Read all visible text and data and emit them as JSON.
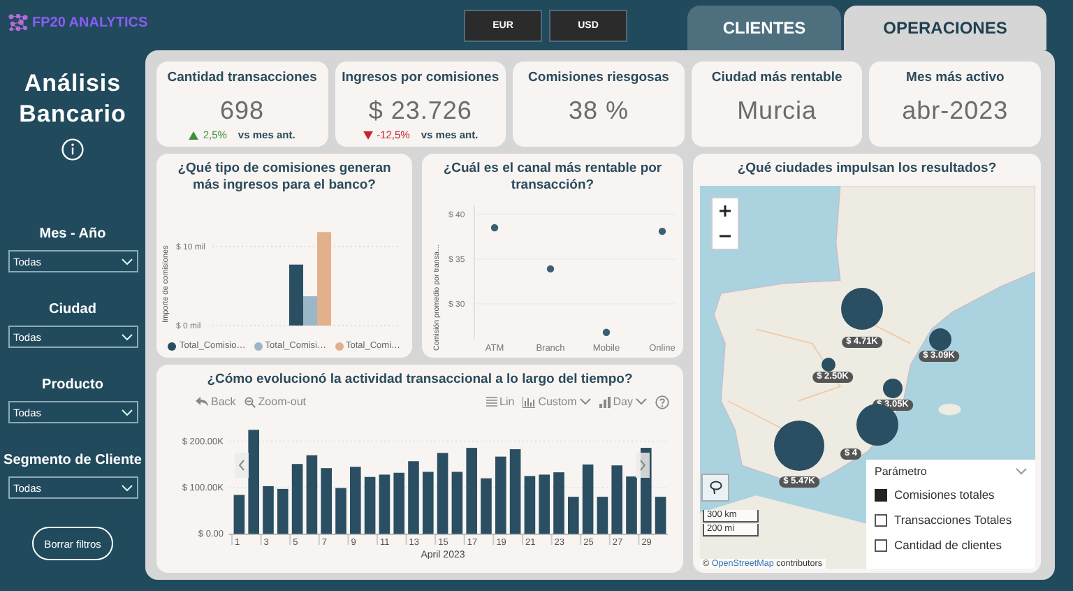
{
  "brand": {
    "name": "FP20 ANALYTICS"
  },
  "currency_buttons": [
    "EUR",
    "USD"
  ],
  "tabs": [
    {
      "label": "CLIENTES",
      "selected": false
    },
    {
      "label": "OPERACIONES",
      "selected": true
    }
  ],
  "sidebar": {
    "title": "Análisis Bancario",
    "filters": [
      {
        "label": "Mes - Año",
        "value": "Todas"
      },
      {
        "label": "Ciudad",
        "value": "Todas"
      },
      {
        "label": "Producto",
        "value": "Todas"
      },
      {
        "label": "Segmento de Cliente",
        "value": "Todas"
      }
    ],
    "clear_button": "Borrar filtros"
  },
  "kpis": [
    {
      "title": "Cantidad transacciones",
      "value": "698",
      "change": {
        "increase": true,
        "value": "2,5%",
        "caption": "vs mes ant."
      }
    },
    {
      "title": "Ingresos por comisiones",
      "value": "$ 23.726",
      "change": {
        "increase": false,
        "value": "-12,5%",
        "caption": "vs mes ant."
      }
    },
    {
      "title": "Comisiones riesgosas",
      "value": "38 %"
    },
    {
      "title": "Ciudad más rentable",
      "value": "Murcia"
    },
    {
      "title": "Mes más activo",
      "value": "abr-2023"
    }
  ],
  "commission_chart": {
    "title": "¿Qué tipo de comisiones generan más ingresos para el banco?",
    "chart_data": {
      "type": "bar",
      "ylabel": "Importe de comisiones",
      "grid": true,
      "ylim": [
        0,
        12
      ],
      "yticks": [
        {
          "value": 0,
          "label": "$ 0 mil"
        },
        {
          "value": 10,
          "label": "$ 10 mil"
        }
      ],
      "series": [
        {
          "name": "Total_Comisio…",
          "color": "#2a4e62",
          "values": [
            7.7
          ]
        },
        {
          "name": "Total_Comisi…",
          "color": "#9ab7c8",
          "values": [
            3.7
          ]
        },
        {
          "name": "Total_Comi…",
          "color": "#e3b08c",
          "values": [
            11.8
          ]
        }
      ]
    }
  },
  "channel_chart": {
    "title": "¿Cuál es el canal más rentable por transacción?",
    "chart_data": {
      "type": "scatter",
      "ylabel": "Comisión promedio por transa…",
      "categories": [
        "ATM",
        "Branch",
        "Mobile",
        "Online"
      ],
      "grid": true,
      "ylim": [
        26,
        41
      ],
      "yticks": [
        {
          "value": 30,
          "label": "$ 30"
        },
        {
          "value": 35,
          "label": "$ 35"
        },
        {
          "value": 40,
          "label": "$ 40"
        }
      ],
      "series": [
        {
          "color": "#3b5f72",
          "values": [
            38.5,
            33.9,
            26.8,
            38.1
          ]
        }
      ]
    }
  },
  "activity_chart": {
    "title": "¿Cómo evolucionó la actividad transaccional a lo largo del tiempo?",
    "toolbar": {
      "back": "Back",
      "zoom_out": "Zoom-out",
      "scale": "Lin",
      "custom": "Custom",
      "period": "Day"
    },
    "chart_data": {
      "type": "bar",
      "xlabel": "April 2023",
      "x": [
        1,
        2,
        3,
        4,
        5,
        6,
        7,
        8,
        9,
        10,
        11,
        12,
        13,
        14,
        15,
        16,
        17,
        18,
        19,
        20,
        21,
        22,
        23,
        24,
        25,
        26,
        27,
        28,
        29,
        30
      ],
      "grid": true,
      "xlim": [
        0.5,
        30.5
      ],
      "xticks": [
        1,
        3,
        5,
        7,
        9,
        11,
        13,
        15,
        17,
        19,
        21,
        23,
        25,
        27,
        29
      ],
      "ylim": [
        0,
        230000
      ],
      "yticks": [
        {
          "value": 0,
          "label": "$ 0.00"
        },
        {
          "value": 100000,
          "label": "$ 100.00K"
        },
        {
          "value": 200000,
          "label": "$ 200.00K"
        }
      ],
      "series": [
        {
          "color": "#2a4e62",
          "values": [
            84000,
            225000,
            103000,
            97000,
            151000,
            170000,
            142000,
            99000,
            145000,
            123000,
            128000,
            132000,
            157000,
            134000,
            175000,
            134000,
            186000,
            120000,
            167000,
            183000,
            125000,
            128000,
            133000,
            80000,
            150000,
            80000,
            148000,
            124000,
            186000,
            80000
          ]
        }
      ]
    }
  },
  "city_map": {
    "title": "¿Qué ciudades impulsan los resultados?",
    "bubbles": [
      {
        "label": "$ 4.71K"
      },
      {
        "label": "$ 3.09K"
      },
      {
        "label": "$ 2.50K"
      },
      {
        "label": "$ 3.05K"
      },
      {
        "label": "$ 4"
      },
      {
        "label": "$ 5.47K"
      }
    ],
    "scale": [
      "300 km",
      "200 mi"
    ],
    "attribution": {
      "symbol": "©",
      "link": "OpenStreetMap",
      "text": "contributors"
    },
    "legend": {
      "title": "Parámetro",
      "options": [
        {
          "label": "Comisiones totales",
          "checked": true
        },
        {
          "label": "Transacciones Totales",
          "checked": false
        },
        {
          "label": "Cantidad de clientes",
          "checked": false
        }
      ]
    }
  }
}
